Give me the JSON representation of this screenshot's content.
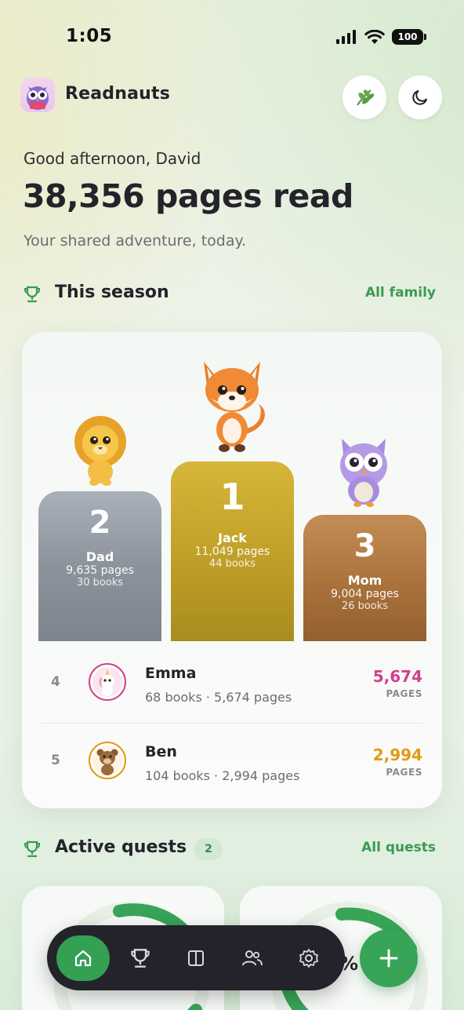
{
  "status_bar": {
    "time": "1:05",
    "battery": "100"
  },
  "app": {
    "name": "Readnauts"
  },
  "greeting": {
    "hello": "Good afternoon, David",
    "headline": "38,356 pages read",
    "subtitle": "Your shared adventure, today."
  },
  "season": {
    "title": "This season",
    "link": "All family",
    "podium": [
      {
        "rank": "2",
        "name": "Dad",
        "pages": "9,635 pages",
        "books": "30 books"
      },
      {
        "rank": "1",
        "name": "Jack",
        "pages": "11,049 pages",
        "books": "44 books"
      },
      {
        "rank": "3",
        "name": "Mom",
        "pages": "9,004 pages",
        "books": "26 books"
      }
    ],
    "rows": [
      {
        "rank": "4",
        "name": "Emma",
        "meta": "68 books · 5,674 pages",
        "pages": "5,674",
        "unit": "PAGES",
        "color": "#d2408a"
      },
      {
        "rank": "5",
        "name": "Ben",
        "meta": "104 books · 2,994 pages",
        "pages": "2,994",
        "unit": "PAGES",
        "color": "#e39a12"
      }
    ]
  },
  "quests": {
    "title": "Active quests",
    "count": "2",
    "link": "All quests",
    "pct_fragment": "%"
  },
  "nav": {
    "items": [
      {
        "icon": "home-icon"
      },
      {
        "icon": "trophy-icon"
      },
      {
        "icon": "book-icon"
      },
      {
        "icon": "family-icon"
      },
      {
        "icon": "gear-icon"
      }
    ],
    "fab_icon": "plus-icon"
  },
  "colors": {
    "accent": "#37a457",
    "gold": "#c4a32a",
    "silver": "#8c939c",
    "bronze": "#a9723b"
  }
}
